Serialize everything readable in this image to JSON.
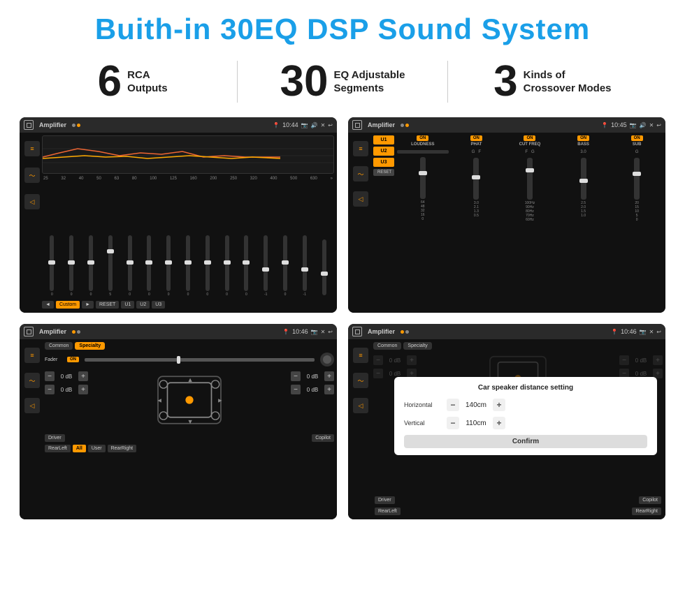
{
  "header": {
    "title": "Buith-in 30EQ DSP Sound System"
  },
  "stats": [
    {
      "number": "6",
      "label": "RCA\nOutputs"
    },
    {
      "number": "30",
      "label": "EQ Adjustable\nSegments"
    },
    {
      "number": "3",
      "label": "Kinds of\nCrossover Modes"
    }
  ],
  "screens": [
    {
      "title": "Amplifier",
      "time": "10:44",
      "type": "eq",
      "eq_freqs": [
        "25",
        "32",
        "40",
        "50",
        "63",
        "80",
        "100",
        "125",
        "160",
        "200",
        "250",
        "320",
        "400",
        "500",
        "630"
      ],
      "eq_values": [
        "0",
        "0",
        "0",
        "5",
        "0",
        "0",
        "0",
        "0",
        "0",
        "0",
        "0",
        "-1",
        "0",
        "-1",
        ""
      ],
      "buttons": [
        "Custom",
        "RESET",
        "U1",
        "U2",
        "U3"
      ]
    },
    {
      "title": "Amplifier",
      "time": "10:45",
      "type": "crossover",
      "presets": [
        "U1",
        "U2",
        "U3"
      ],
      "channels": [
        "LOUDNESS",
        "PHAT",
        "CUT FREQ",
        "BASS",
        "SUB"
      ],
      "reset": "RESET"
    },
    {
      "title": "Amplifier",
      "time": "10:46",
      "type": "fader",
      "tabs": [
        "Common",
        "Specialty"
      ],
      "fader_label": "Fader",
      "fader_on": "ON",
      "zones": [
        "Driver",
        "Copilot",
        "RearLeft",
        "RearRight"
      ],
      "all_btn": "All",
      "user_btn": "User",
      "db_values": [
        "0 dB",
        "0 dB",
        "0 dB",
        "0 dB"
      ]
    },
    {
      "title": "Amplifier",
      "time": "10:46",
      "type": "distance",
      "tabs": [
        "Common",
        "Specialty"
      ],
      "dialog_title": "Car speaker distance setting",
      "horizontal_label": "Horizontal",
      "horizontal_value": "140cm",
      "vertical_label": "Vertical",
      "vertical_value": "110cm",
      "confirm_label": "Confirm",
      "db_values": [
        "0 dB",
        "0 dB"
      ],
      "zones": [
        "Driver",
        "Copilot",
        "RearLeft",
        "RearRight"
      ]
    }
  ],
  "colors": {
    "accent": "#f90",
    "blue": "#1a9fe8",
    "dark_bg": "#1a1a1a",
    "text_light": "#ccc"
  }
}
